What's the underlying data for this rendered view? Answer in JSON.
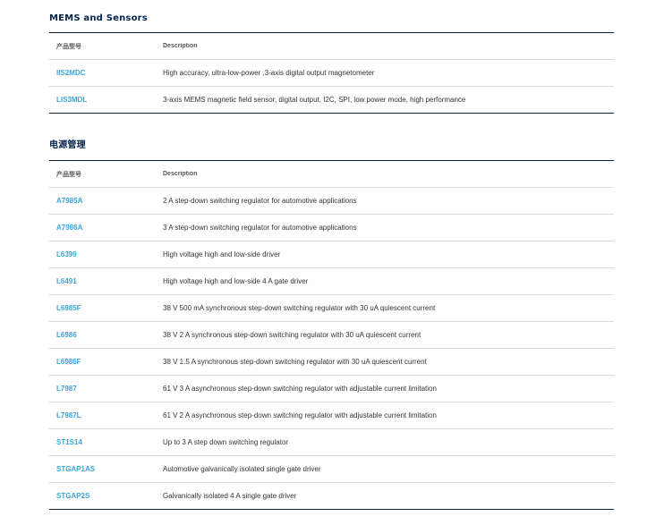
{
  "sections": [
    {
      "title": "MEMS and Sensors",
      "headers": {
        "part_number": "产品型号",
        "description": "Description"
      },
      "rows": [
        {
          "part_number": "IIS2MDC",
          "description": "High accuracy, ultra-low-power ,3-axis digital output magnetometer"
        },
        {
          "part_number": "LIS3MDL",
          "description": "3-axis MEMS magnetic field sensor, digital output, I2C, SPI, low power mode, high performance"
        }
      ]
    },
    {
      "title": "电源管理",
      "headers": {
        "part_number": "产品型号",
        "description": "Description"
      },
      "rows": [
        {
          "part_number": "A7985A",
          "description": "2 A step-down switching regulator for automotive applications"
        },
        {
          "part_number": "A7986A",
          "description": "3 A step-down switching regulator for automotive applications"
        },
        {
          "part_number": "L6399",
          "description": "High voltage high and low-side driver"
        },
        {
          "part_number": "L6491",
          "description": "High voltage high and low-side 4 A gate driver"
        },
        {
          "part_number": "L6985F",
          "description": "38 V 500 mA synchronous step-down switching regulator with 30 uA quiescent current"
        },
        {
          "part_number": "L6986",
          "description": "38 V 2 A synchronous step-down switching regulator with 30 uA quiescent current"
        },
        {
          "part_number": "L6986F",
          "description": "38 V 1.5 A synchronous step-down switching regulator with 30 uA quiescent current"
        },
        {
          "part_number": "L7987",
          "description": "61 V 3 A asynchronous step-down switching regulator with adjustable current limitation"
        },
        {
          "part_number": "L7987L",
          "description": "61 V 2 A asynchronous step-down switching regulator with adjustable current limitation"
        },
        {
          "part_number": "ST1S14",
          "description": "Up to 3 A step down switching regulator"
        },
        {
          "part_number": "STGAP1AS",
          "description": "Automotive galvanically isolated single gate driver"
        },
        {
          "part_number": "STGAP2S",
          "description": "Galvanically isolated 4 A single gate driver"
        }
      ]
    }
  ]
}
